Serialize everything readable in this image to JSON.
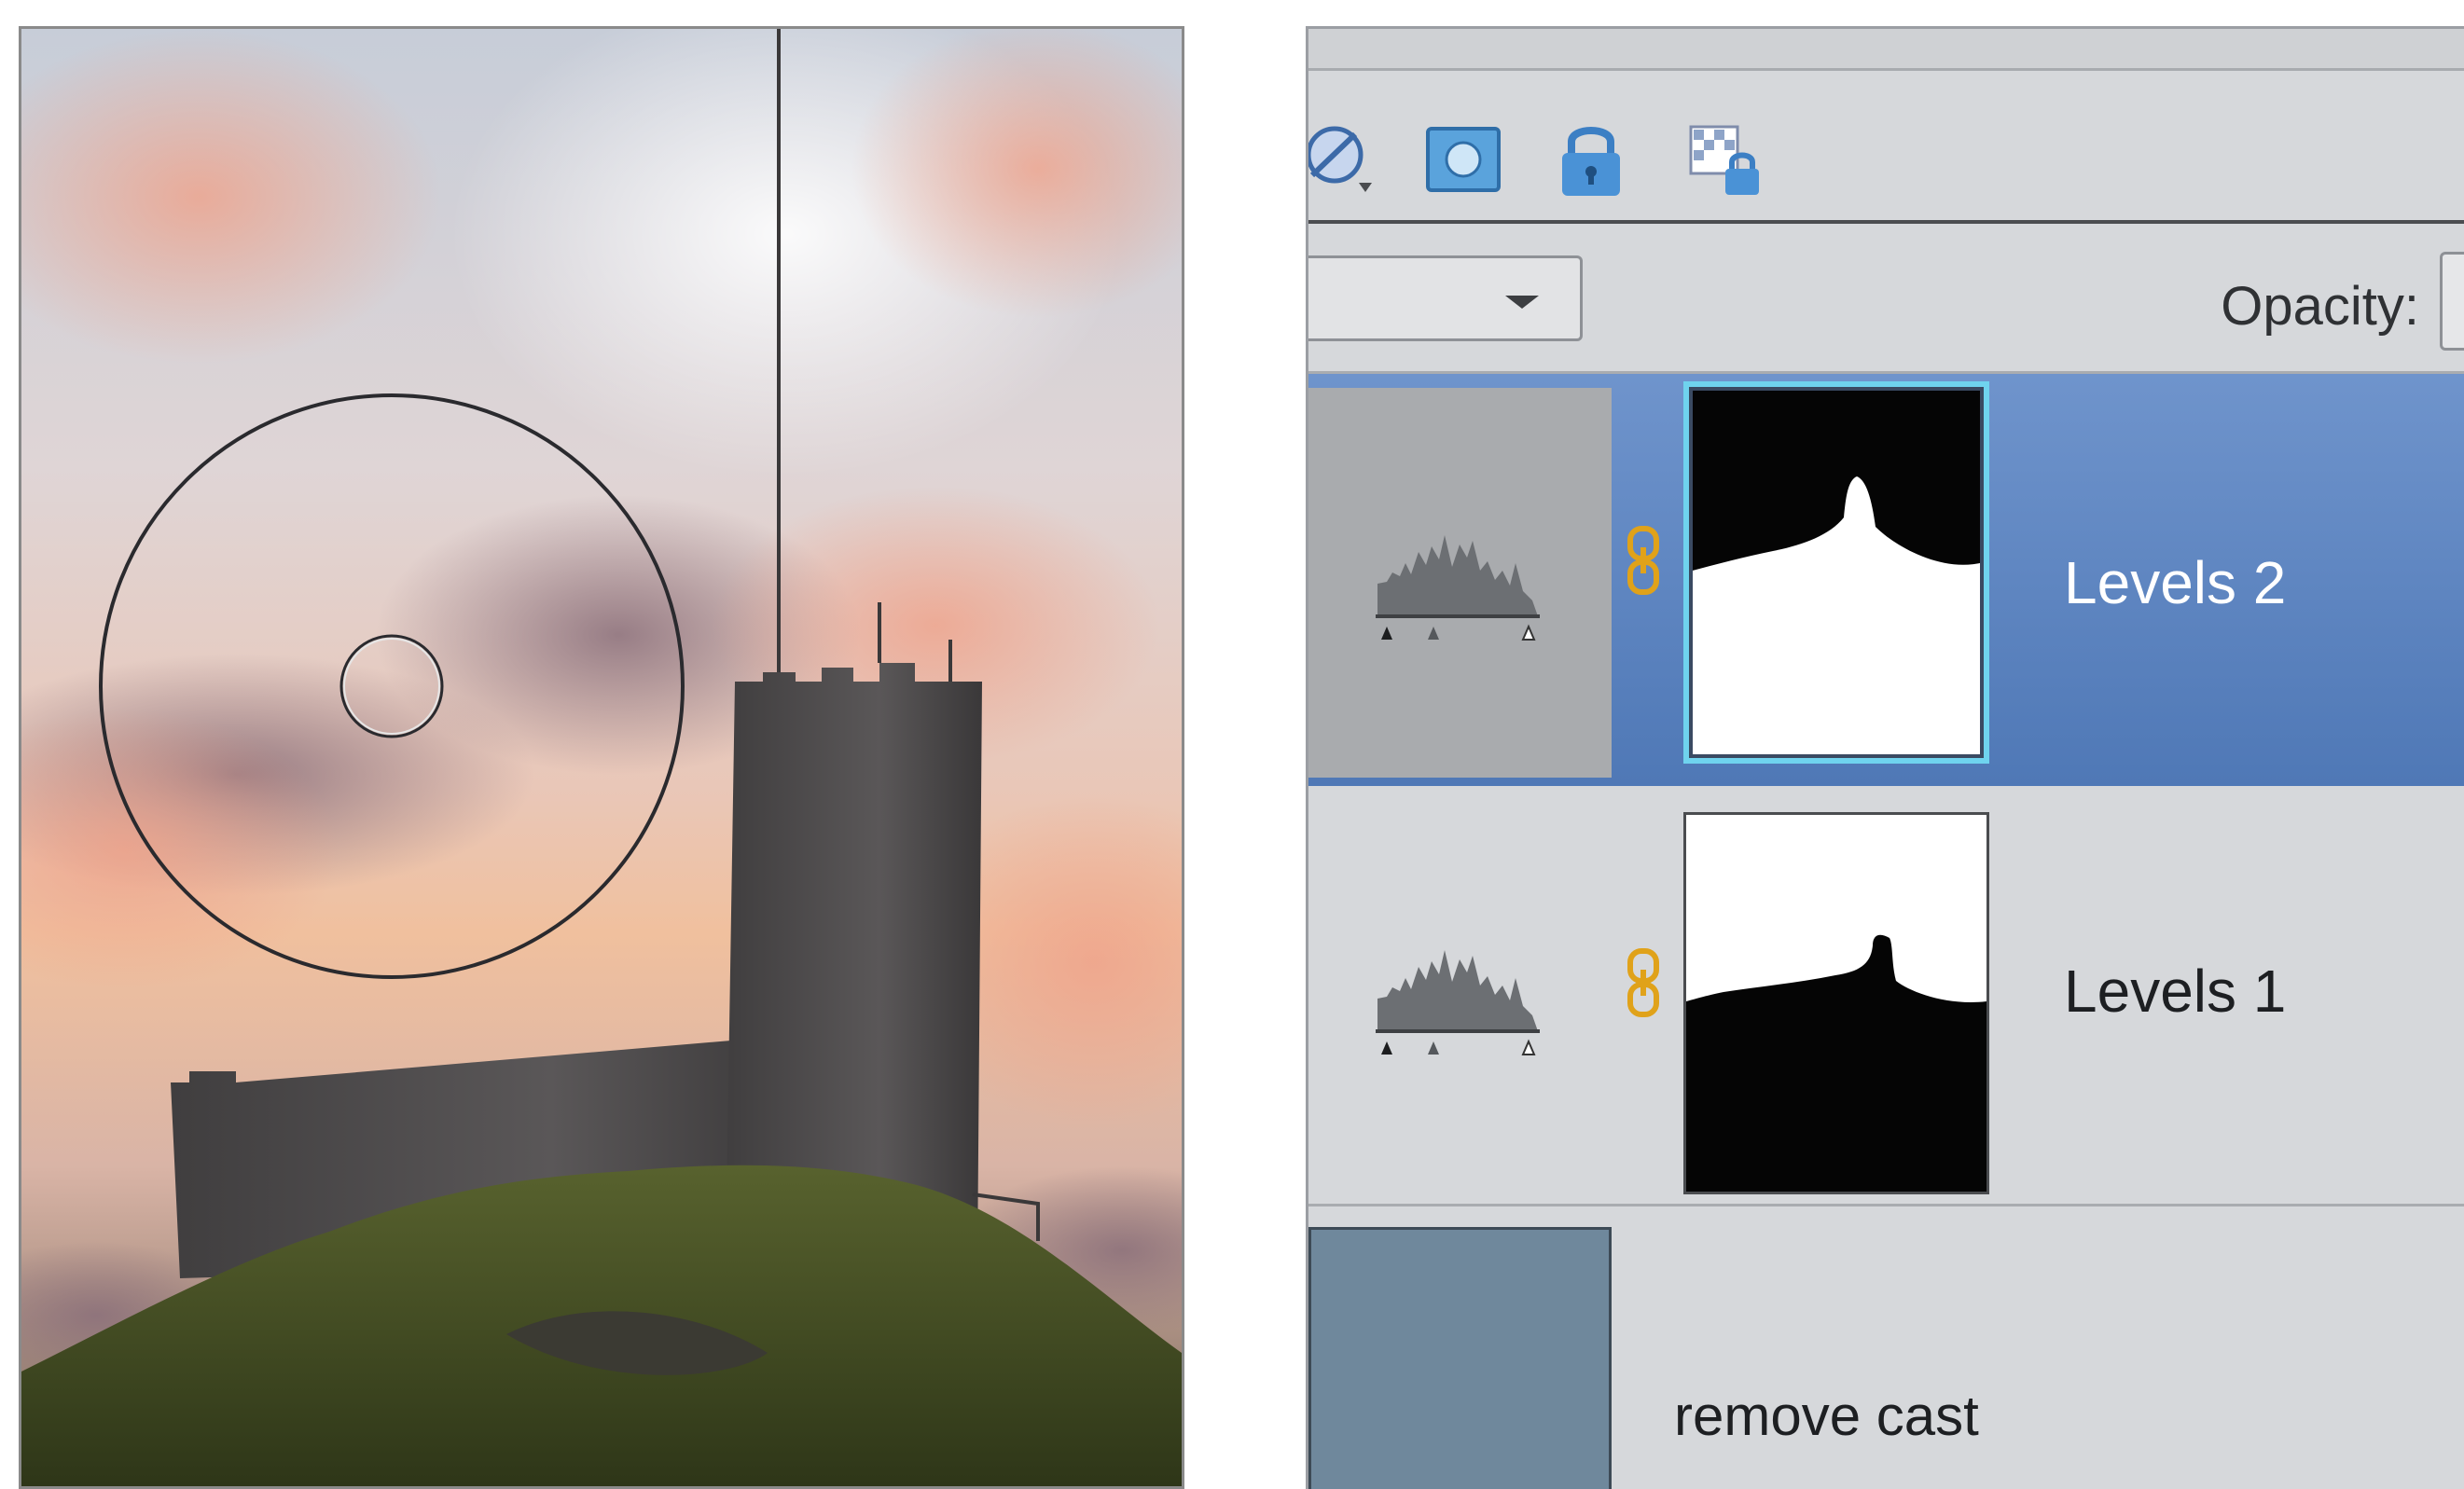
{
  "toolbar": {
    "icons": [
      "blend-mode-icon",
      "mask-icon",
      "lock-icon",
      "lock-transparency-icon"
    ]
  },
  "blend": {
    "opacity_label": "Opacity:"
  },
  "layers": [
    {
      "name": "Levels 2",
      "selected": true,
      "type": "levels-adjustment",
      "mask": "sky-revealed"
    },
    {
      "name": "Levels 1",
      "selected": false,
      "type": "levels-adjustment",
      "mask": "land-revealed"
    },
    {
      "name": "remove cast",
      "selected": false,
      "type": "color-fill"
    }
  ],
  "colors": {
    "selected_row": "#4f78b6",
    "panel_bg": "#d6d8db",
    "link_icon": "#e0a21a",
    "mask_selected_border": "#6fd3ee",
    "cast_fill": "#6f889c"
  }
}
